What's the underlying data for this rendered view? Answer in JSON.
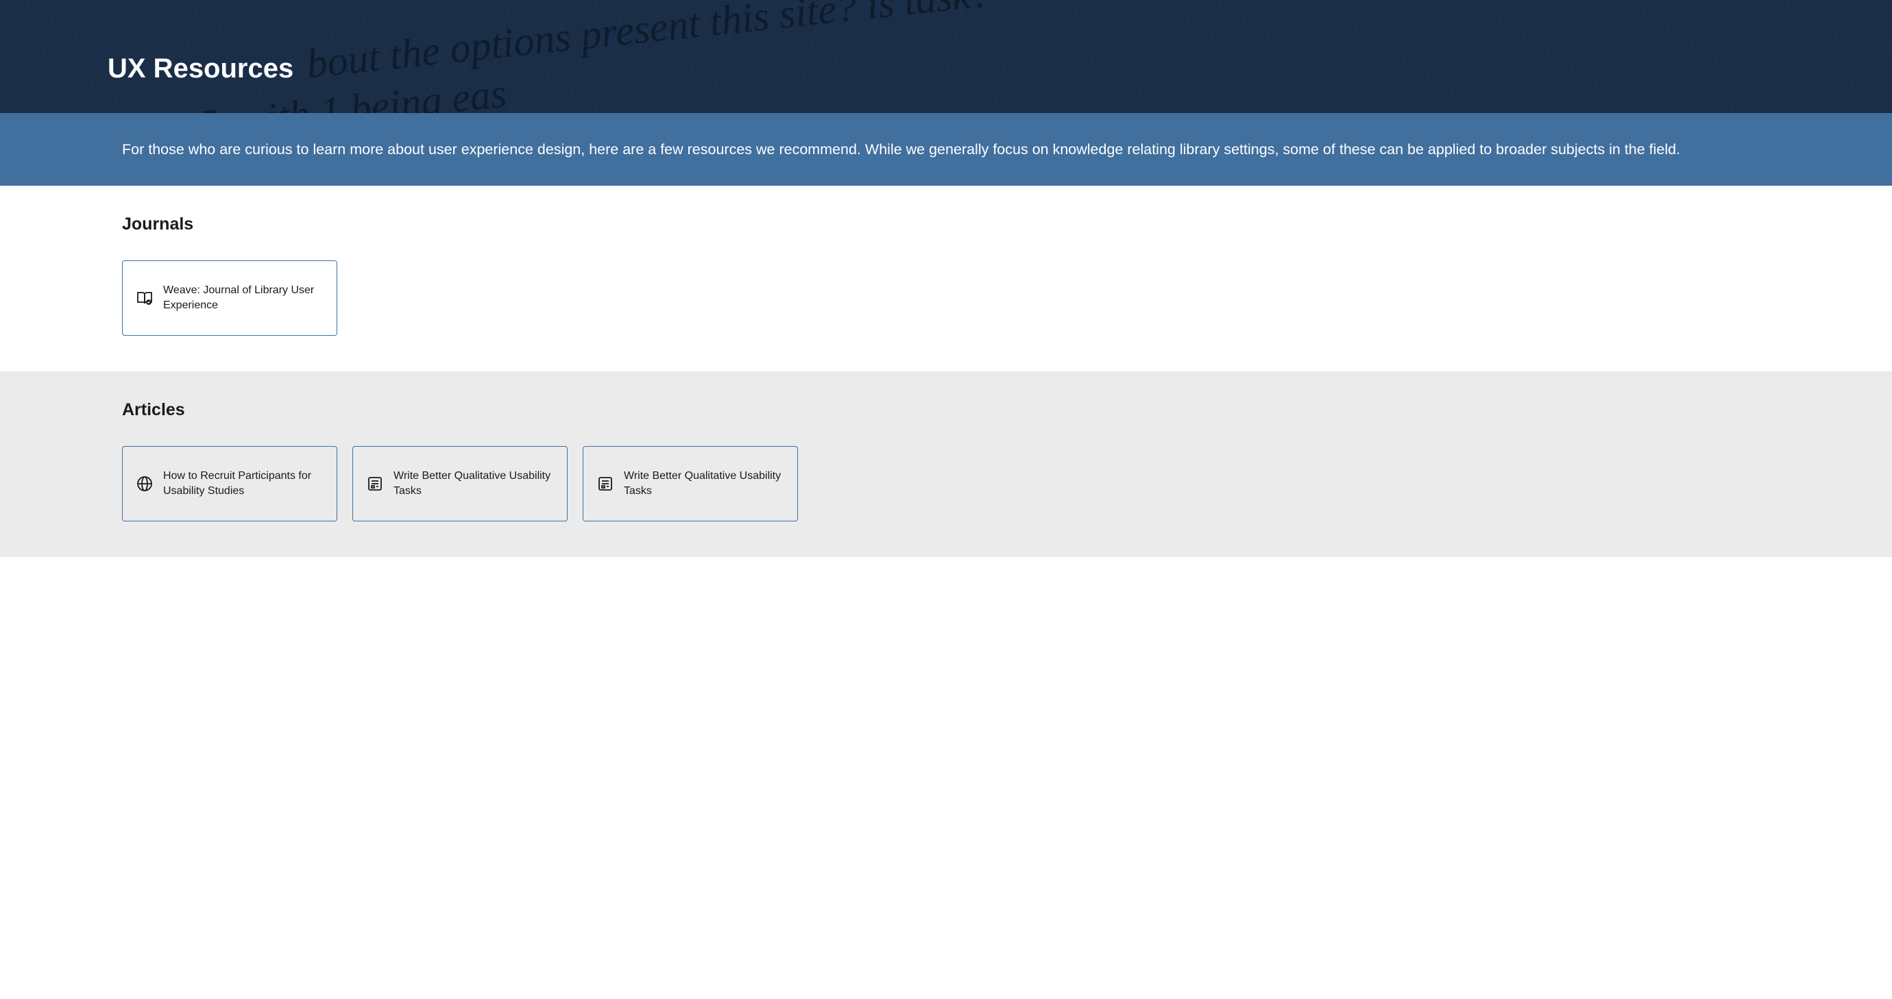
{
  "hero": {
    "title": "UX Resources"
  },
  "intro": {
    "text": "For those who are curious to learn more about user experience design, here are a few resources we recommend. While we generally focus on knowledge relating library settings, some of these can be applied to broader subjects in the field."
  },
  "journals": {
    "heading": "Journals",
    "items": [
      {
        "title": "Weave: Journal of Library User Experience",
        "icon": "book"
      }
    ]
  },
  "articles": {
    "heading": "Articles",
    "items": [
      {
        "title": "How to Recruit Participants for Usability Studies",
        "icon": "globe"
      },
      {
        "title": "Write Better Qualitative Usability Tasks",
        "icon": "article"
      },
      {
        "title": "Write Better Qualitative Usability Tasks",
        "icon": "article"
      }
    ]
  }
}
